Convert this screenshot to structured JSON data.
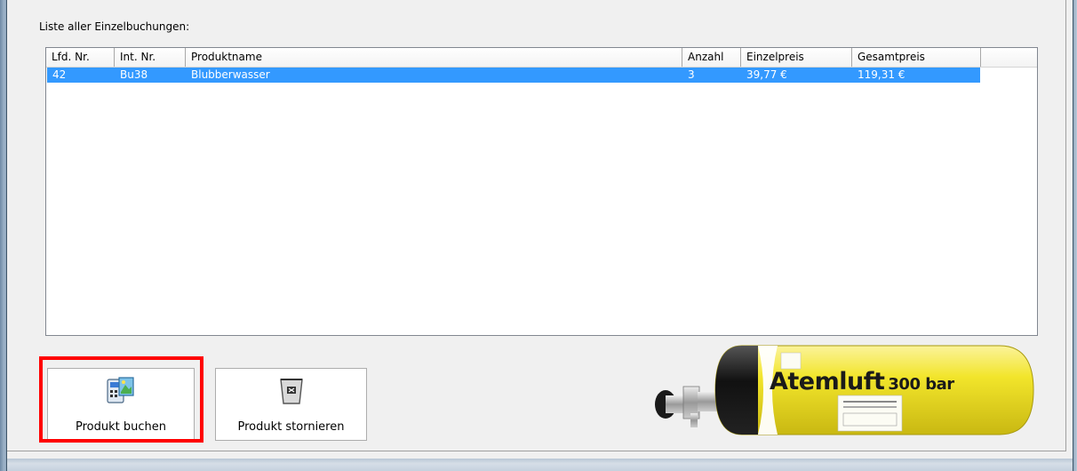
{
  "list_caption": "Liste aller Einzelbuchungen:",
  "table": {
    "columns": [
      "Lfd. Nr.",
      "Int. Nr.",
      "Produktname",
      "Anzahl",
      "Einzelpreis",
      "Gesamtpreis"
    ],
    "rows": [
      {
        "lfd_nr": "42",
        "int_nr": "Bu38",
        "produktname": "Blubberwasser",
        "anzahl": "3",
        "einzelpreis": "39,77 €",
        "gesamtpreis": "119,31 €"
      }
    ],
    "selected_row_color": "#3399ff"
  },
  "buttons": {
    "book": {
      "label": "Produkt buchen",
      "icon": "book-product-icon"
    },
    "cancel": {
      "label": "Produkt stornieren",
      "icon": "trash-bin-icon"
    }
  },
  "highlight_color": "#ff0000",
  "tank_graphic": {
    "label_main": "Atemluft",
    "label_pressure": "300 bar",
    "color": "#f2e52b"
  }
}
